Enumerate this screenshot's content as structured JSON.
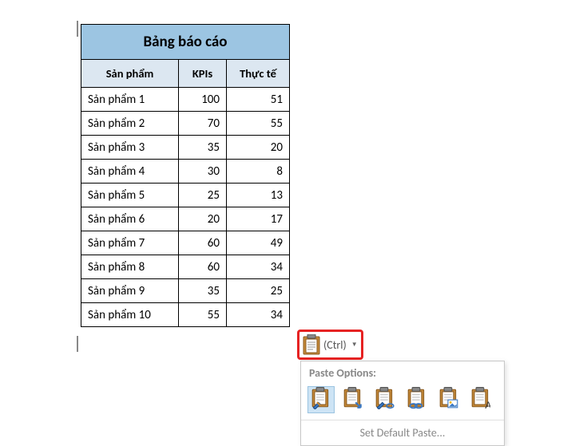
{
  "table": {
    "title": "Bảng báo cáo",
    "headers": {
      "product": "Sản phẩm",
      "kpis": "KPIs",
      "actual": "Thực tế"
    },
    "rows": [
      {
        "product": "Sản phẩm 1",
        "kpis": "100",
        "actual": "51"
      },
      {
        "product": "Sản phẩm 2",
        "kpis": "70",
        "actual": "55"
      },
      {
        "product": "Sản phẩm 3",
        "kpis": "35",
        "actual": "20"
      },
      {
        "product": "Sản phẩm 4",
        "kpis": "30",
        "actual": "8"
      },
      {
        "product": "Sản phẩm 5",
        "kpis": "25",
        "actual": "13"
      },
      {
        "product": "Sản phẩm 6",
        "kpis": "20",
        "actual": "17"
      },
      {
        "product": "Sản phẩm 7",
        "kpis": "60",
        "actual": "49"
      },
      {
        "product": "Sản phẩm 8",
        "kpis": "60",
        "actual": "34"
      },
      {
        "product": "Sản phẩm 9",
        "kpis": "35",
        "actual": "25"
      },
      {
        "product": "Sản phẩm 10",
        "kpis": "55",
        "actual": "34"
      }
    ]
  },
  "paste_button": {
    "label": "(Ctrl)"
  },
  "paste_options": {
    "header": "Paste Options:",
    "footer": "Set Default Paste...",
    "items": [
      {
        "name": "keep-source-formatting",
        "selected": true,
        "decor": "brush"
      },
      {
        "name": "merge-formatting",
        "selected": false,
        "decor": "arrow"
      },
      {
        "name": "use-destination-styles",
        "selected": false,
        "decor": "brush-link"
      },
      {
        "name": "link-keep-source",
        "selected": false,
        "decor": "link"
      },
      {
        "name": "picture",
        "selected": false,
        "decor": "picture"
      },
      {
        "name": "keep-text-only",
        "selected": false,
        "decor": "letter"
      }
    ]
  },
  "colors": {
    "title_bg": "#9cc5e2",
    "header_bg": "#dce7f1",
    "highlight_border": "#e62222",
    "selected_bg": "#cde4f5"
  }
}
